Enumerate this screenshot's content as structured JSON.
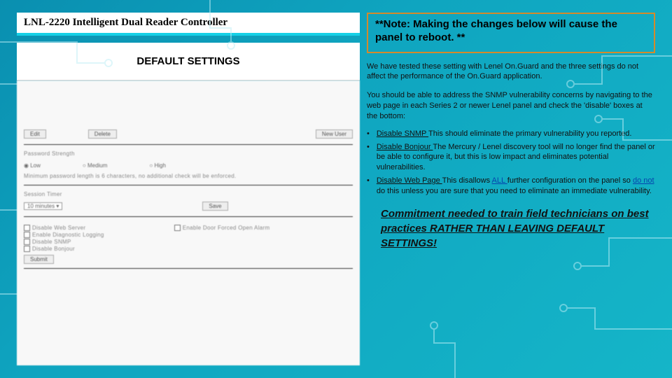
{
  "left": {
    "panelTitle": "LNL-2220 Intelligent Dual Reader Controller",
    "heading": "DEFAULT SETTINGS",
    "buttons": {
      "edit": "Edit",
      "delete": "Delete",
      "newUser": "New User"
    },
    "pwStrengthLabel": "Password Strength",
    "pwRadios": {
      "low": "Low",
      "medium": "Medium",
      "high": "High"
    },
    "pwNote": "Minimum password length is 6 characters, no additional check will be enforced.",
    "sessionLabel": "Session Timer",
    "sessionValue": "10 minutes ▾",
    "saveBtn": "Save",
    "checkboxes": {
      "disableWeb": "Disable Web Server",
      "enableDoor": "Enable Door Forced Open Alarm",
      "enableDiag": "Enable Diagnostic Logging",
      "disableSnmp": "Disable SNMP",
      "disableBonjour": "Disable Bonjour"
    },
    "submit": "Submit"
  },
  "right": {
    "noteBox": "**Note: Making the changes below will cause the panel to reboot. **",
    "p1": "We have tested these setting with Lenel On.Guard and the three settings do not affect the performance of the On.Guard application.",
    "p2": "You should be able to address the SNMP vulnerability concerns by navigating to the web page in each Series 2 or newer Lenel panel and check the 'disable' boxes at the bottom:",
    "bullets": {
      "b1a": "Disable SNMP ",
      "b1b": "This should eliminate the primary vulnerability you reported.",
      "b2a": "Disable Bonjour ",
      "b2b": "The Mercury / Lenel discovery tool will no longer find the panel or be able to configure it, but this is low impact and eliminates potential vulnerabilities.",
      "b3a": "Disable Web Page ",
      "b3b1": "This disallows ",
      "b3all": "ALL ",
      "b3b2": "further configuration on the panel so ",
      "b3donot": "do not ",
      "b3b3": "do this unless you are sure that you need to eliminate an immediate vulnerability."
    },
    "kicker1": "Commitment needed to train field technicians on ",
    "kickerEm": "best practices",
    "kicker2": " RATHER THAN LEAVING DEFAULT SETTINGS!"
  }
}
